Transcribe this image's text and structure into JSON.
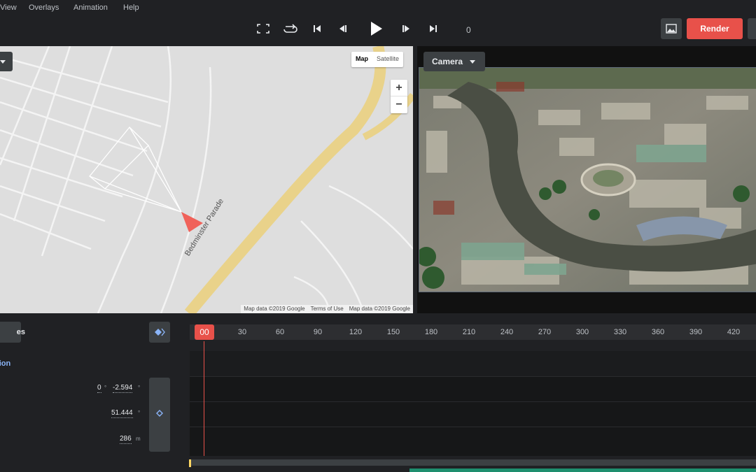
{
  "menu": {
    "view": "View",
    "overlays": "Overlays",
    "animation": "Animation",
    "help": "Help"
  },
  "transport": {
    "frame": "0",
    "render_label": "Render"
  },
  "map": {
    "type_map": "Map",
    "type_satellite": "Satellite",
    "zoom_in": "+",
    "zoom_out": "−",
    "street_label": "Bedminster Parade",
    "attribution": [
      "Map data ©2019 Google",
      "Terms of Use",
      "Map data ©2019 Google"
    ]
  },
  "camera": {
    "dropdown_label": "Camera"
  },
  "timeline": {
    "keyframes_label": "es",
    "current_frame": "00",
    "ticks": [
      "30",
      "60",
      "90",
      "120",
      "150",
      "180",
      "210",
      "240",
      "270",
      "300",
      "330",
      "360",
      "390",
      "420"
    ],
    "section": "ition",
    "rows": [
      {
        "value_a": "0",
        "value_b": "-2.594",
        "unit": "°"
      },
      {
        "value": "51.444",
        "unit": "°"
      },
      {
        "value": "286",
        "unit": "m"
      }
    ]
  },
  "colors": {
    "accent": "#e8514a",
    "panel": "#3c4043",
    "background": "#202124",
    "section_label": "#8ab4f8",
    "keyframe_diamond": "#8ab4f8"
  }
}
